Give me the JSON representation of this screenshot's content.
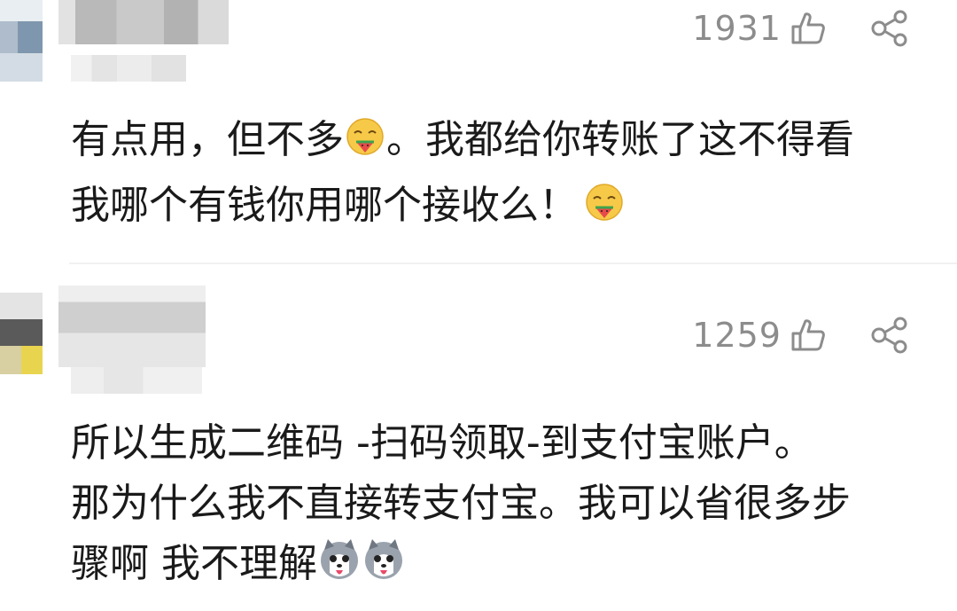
{
  "comments": [
    {
      "like_count": "1931",
      "lines": [
        "有点用，但不多",
        "。我都给你转账了这不得看",
        "我哪个有钱你用哪个接收么！"
      ],
      "emojis": [
        "melon-eating-emoji",
        "melon-eating-emoji"
      ]
    },
    {
      "like_count": "1259",
      "lines": [
        "所以生成二维码 -扫码领取-到支付宝账户。",
        "那为什么我不直接转支付宝。我可以省很多步",
        "骤啊 我不理解"
      ],
      "emojis": [
        "husky-dog-emoji",
        "husky-dog-emoji"
      ]
    }
  ],
  "icons": {
    "like": "thumbs-up-icon",
    "share": "share-icon"
  },
  "colors": {
    "text": "#1a1a1a",
    "meta": "#8c8c8c",
    "emoji_face": "#f7c948",
    "divider": "#f1f1f1"
  }
}
